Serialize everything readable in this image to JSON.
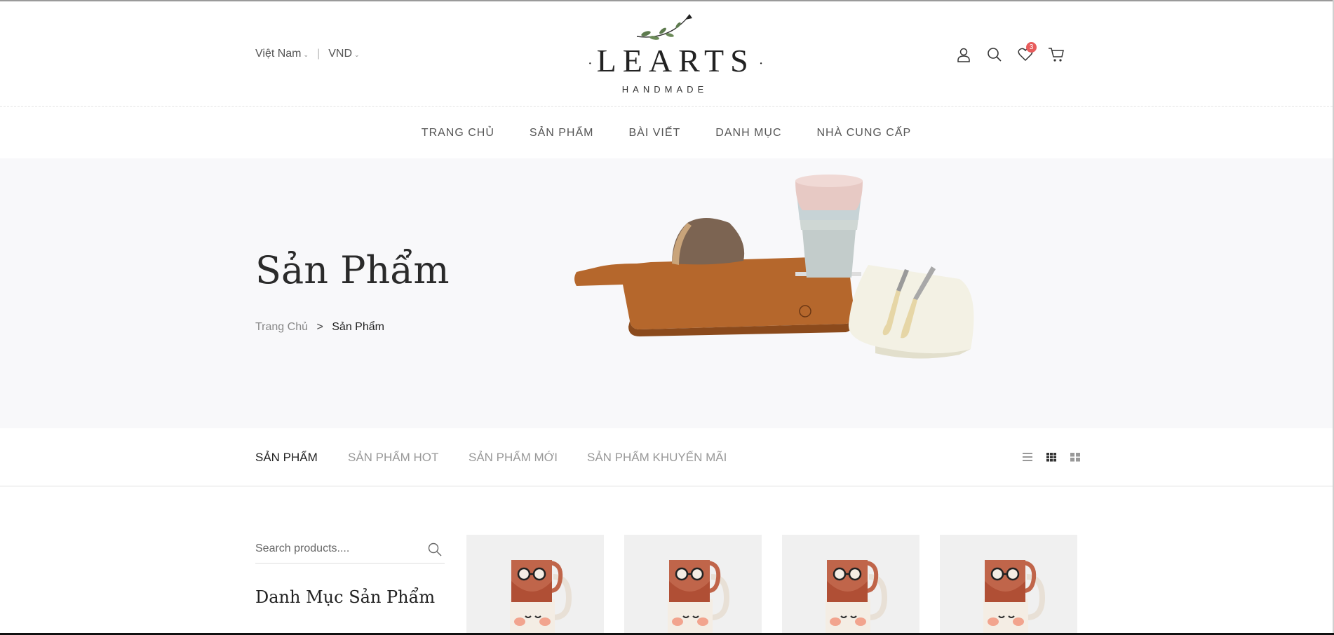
{
  "header": {
    "country": "Việt Nam",
    "currency": "VND",
    "separator": "|",
    "logo_main": "LEARTS",
    "logo_sub": "HANDMADE",
    "wishlist_count": "3"
  },
  "nav": [
    "TRANG CHỦ",
    "SẢN PHẨM",
    "BÀI VIẾT",
    "DANH MỤC",
    "NHÀ CUNG CẤP"
  ],
  "hero": {
    "title": "Sản Phẩm",
    "breadcrumb": {
      "home": "Trang Chủ",
      "separator": ">",
      "current": "Sản Phẩm"
    }
  },
  "tabs": [
    "SẢN PHẨM",
    "SẢN PHẨM HOT",
    "SẢN PHẨM MỚI",
    "SẢN PHẨM KHUYẾN MÃI"
  ],
  "views": [
    "list-view-icon",
    "grid-view-icon",
    "large-grid-view-icon"
  ],
  "sidebar": {
    "search_placeholder": "Search products....",
    "category_title": "Danh Mục Sản Phẩm"
  },
  "colors": {
    "badge": "#e85c5c",
    "hero_bg": "#f8f8fa",
    "card_bg": "#f0f0f0"
  }
}
